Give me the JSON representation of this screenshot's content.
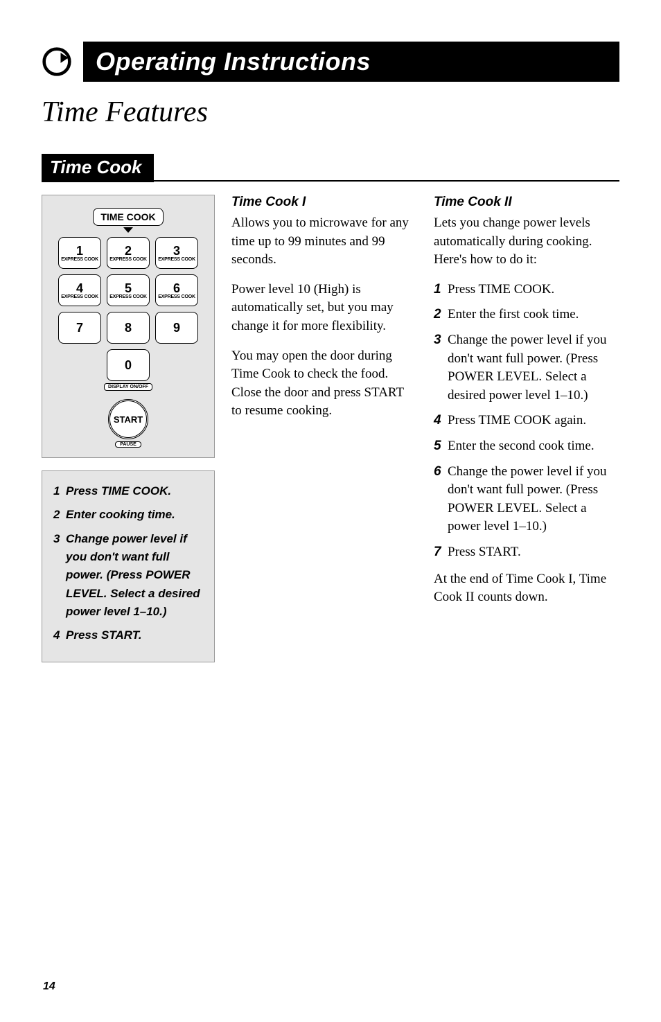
{
  "header": {
    "main_title": "Operating Instructions",
    "section_title": "Time Features",
    "sub_bar": "Time Cook"
  },
  "keypad": {
    "time_cook_label": "TIME COOK",
    "keys": [
      {
        "num": "1",
        "sub": "EXPRESS COOK"
      },
      {
        "num": "2",
        "sub": "EXPRESS COOK"
      },
      {
        "num": "3",
        "sub": "EXPRESS COOK"
      },
      {
        "num": "4",
        "sub": "EXPRESS COOK"
      },
      {
        "num": "5",
        "sub": "EXPRESS COOK"
      },
      {
        "num": "6",
        "sub": "EXPRESS COOK"
      },
      {
        "num": "7",
        "sub": ""
      },
      {
        "num": "8",
        "sub": ""
      },
      {
        "num": "9",
        "sub": ""
      }
    ],
    "zero_num": "0",
    "display_label": "DISPLAY ON/OFF",
    "start_label": "START",
    "pause_label": "PAUSE"
  },
  "quick_steps": [
    {
      "n": "1",
      "t": "Press TIME COOK."
    },
    {
      "n": "2",
      "t": "Enter cooking time."
    },
    {
      "n": "3",
      "t": "Change power level if you don't want full power. (Press POWER LEVEL. Select a desired power level 1–10.)"
    },
    {
      "n": "4",
      "t": "Press START."
    }
  ],
  "col2": {
    "heading": "Time Cook I",
    "p1": "Allows you to microwave for any time up to 99 minutes and 99 seconds.",
    "p2": "Power level 10 (High) is automatically set, but you may change it for more flexibility.",
    "p3": "You may open the door during Time Cook to check the food. Close the door and press START to resume cooking."
  },
  "col3": {
    "heading": "Time Cook II",
    "intro": "Lets you change power levels automatically during cooking. Here's how to do it:",
    "steps": [
      {
        "n": "1",
        "t": "Press TIME COOK."
      },
      {
        "n": "2",
        "t": "Enter the first cook time."
      },
      {
        "n": "3",
        "t": "Change the power level if you don't want full power. (Press POWER LEVEL. Select a desired power level 1–10.)"
      },
      {
        "n": "4",
        "t": "Press TIME COOK again."
      },
      {
        "n": "5",
        "t": "Enter the second cook time."
      },
      {
        "n": "6",
        "t": "Change the power level if you don't want full power. (Press POWER LEVEL. Select a power level 1–10.)"
      },
      {
        "n": "7",
        "t": "Press START."
      }
    ],
    "outro": "At the end of Time Cook I, Time Cook II counts down."
  },
  "page_number": "14"
}
